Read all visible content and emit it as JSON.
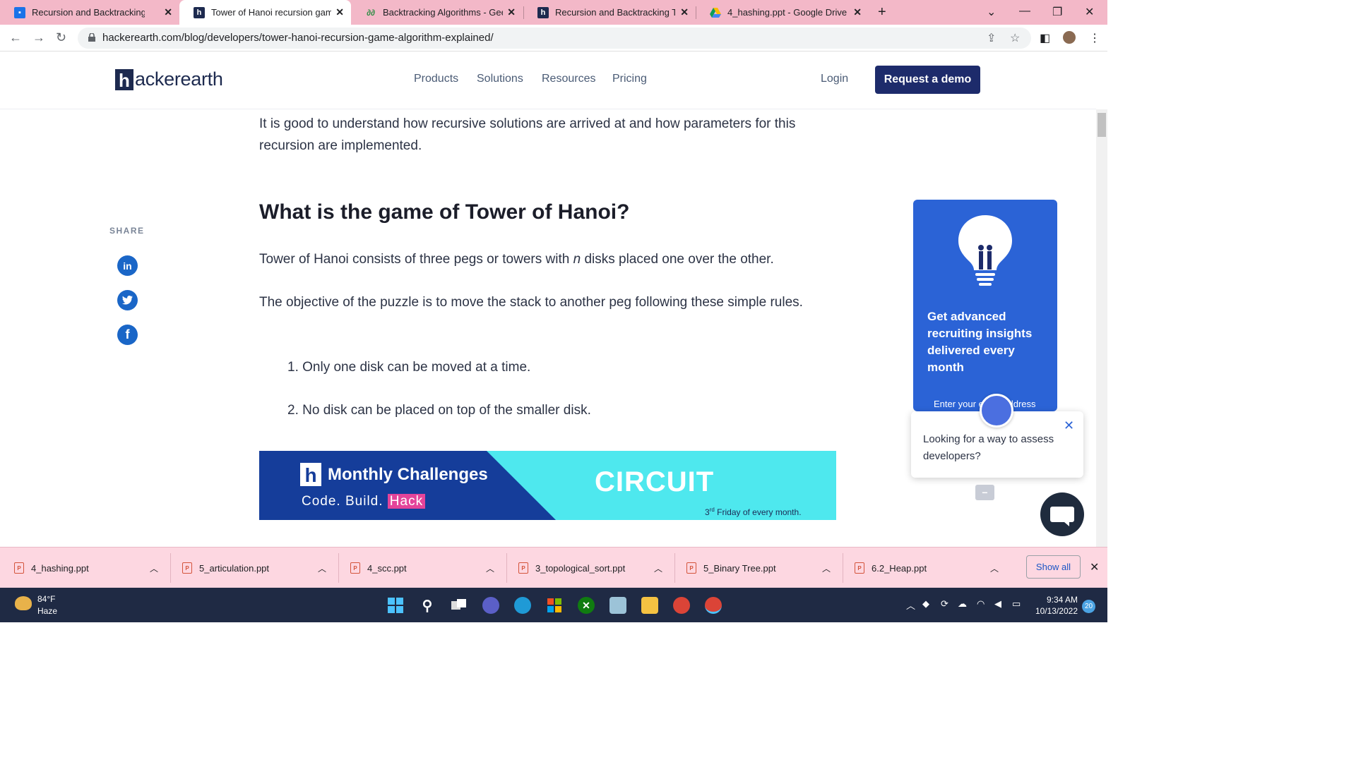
{
  "tabs": [
    {
      "title": "Recursion and Backtracking",
      "active": false
    },
    {
      "title": "Tower of Hanoi recursion game a",
      "active": true
    },
    {
      "title": "Backtracking Algorithms - Geeks",
      "active": false
    },
    {
      "title": "Recursion and Backtracking Tuto",
      "active": false
    },
    {
      "title": "4_hashing.ppt - Google Drive",
      "active": false
    }
  ],
  "address": {
    "url": "hackerearth.com/blog/developers/tower-hanoi-recursion-game-algorithm-explained/"
  },
  "site": {
    "logo_text": "ackerearth",
    "logo_letter": "h",
    "nav": [
      "Products",
      "Solutions",
      "Resources",
      "Pricing"
    ],
    "login": "Login",
    "demo": "Request a demo"
  },
  "article": {
    "intro": "It is good to understand how recursive solutions are arrived at and how parameters for this recursion are implemented.",
    "heading": "What is the game of Tower of Hanoi?",
    "p1_before": "Tower of Hanoi consists of three pegs or towers with ",
    "p1_n": "n",
    "p1_after": " disks placed one over the other.",
    "p2": "The objective of the puzzle is to move the stack to another peg following these simple rules.",
    "rules": [
      "1. Only one disk can be moved at a time.",
      "2. No disk can be placed on top of the smaller disk."
    ]
  },
  "share": {
    "label": "SHARE",
    "icons": [
      "linkedin-icon",
      "twitter-icon",
      "facebook-icon"
    ]
  },
  "banner": {
    "logo_letter": "h",
    "title": "Monthly Challenges",
    "tag_prefix": "Code. Build. ",
    "tag_hack": "Hack",
    "event": "CIRCUIT",
    "schedule_rd": "rd",
    "schedule_num": "3",
    "schedule_rest": " Friday of every month."
  },
  "sidebar": {
    "card_text": "Get advanced recruiting insights delivered every month",
    "email_placeholder": "Enter your email address"
  },
  "chat": {
    "message": "Looking for a way to assess developers?"
  },
  "downloads": [
    "4_hashing.ppt",
    "5_articulation.ppt",
    "4_scc.ppt",
    "3_topological_sort.ppt",
    "5_Binary Tree.ppt",
    "6.2_Heap.ppt"
  ],
  "download_shelf": {
    "show_all": "Show all"
  },
  "taskbar": {
    "temp": "84°F",
    "condition": "Haze",
    "time": "9:34 AM",
    "date": "10/13/2022",
    "notifications": "20"
  },
  "colors": {
    "brand": "#1d2b6b",
    "tab_strip": "#f3b8c8",
    "card": "#2b63d6",
    "shelf": "#fdd7e1"
  }
}
